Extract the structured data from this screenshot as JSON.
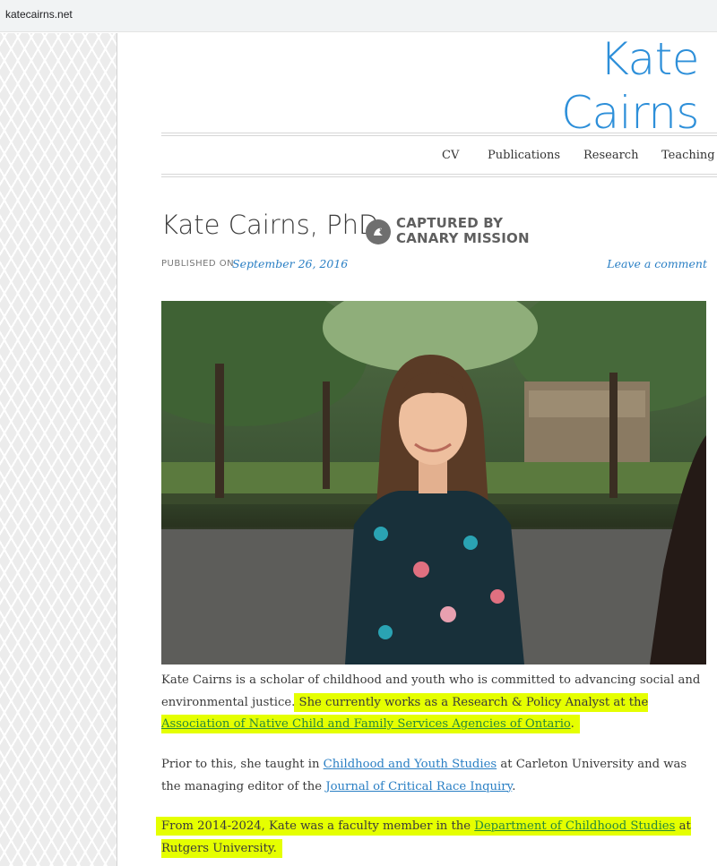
{
  "browser": {
    "url": "katecairns.net"
  },
  "site": {
    "title": "Kate Cairns",
    "nav": [
      "CV",
      "Publications",
      "Research",
      "Teaching"
    ]
  },
  "post": {
    "title": "Kate Cairns, PhD",
    "badge": {
      "line1": "CAPTURED BY",
      "line2": "CANARY MISSION",
      "icon": "canary-bird-icon"
    },
    "published_label": "PUBLISHED ON",
    "published_date": "September 26, 2016",
    "comment_link": "Leave a comment",
    "photo_alt": "Portrait of Kate Cairns"
  },
  "body": {
    "p1": {
      "text1": "Kate Cairns is a scholar of childhood and youth who is committed to advancing social and environmental justice. ",
      "highlight": "She currently works as a Research & Policy Analyst at the ",
      "link": "Association of Native Child and Family Services Agencies of Ontario",
      "end": "."
    },
    "p2": {
      "text1": "Prior to this, she taught in ",
      "link1": "Childhood and Youth Studies",
      "text2": " at Carleton University and was the managing editor of the ",
      "link2": "Journal of Critical Race Inquiry",
      "end": "."
    },
    "p3": {
      "text1": "From 2014-2024, Kate was a faculty member in the ",
      "link": "Department of Childhood Studies",
      "text2": " at Rutgers University. "
    }
  },
  "colors": {
    "accent": "#2d8fd9",
    "link": "#2a7fc4",
    "highlight": "#e5ff00"
  }
}
